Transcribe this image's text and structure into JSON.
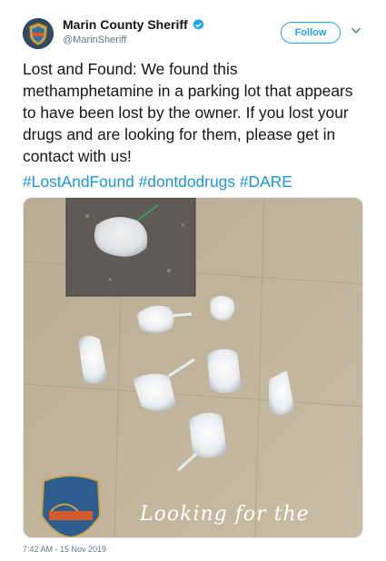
{
  "author": {
    "name": "Marin County Sheriff",
    "handle": "@MarinSheriff",
    "verified_icon": "verified-badge-icon",
    "follow_label": "Follow"
  },
  "tweet": {
    "text": "Lost and Found: We found this methamphetamine in a parking lot that appears to have been lost by the owner. If you lost your drugs and are looking for them, please get in contact with us!",
    "hashtags": [
      "#LostAndFound",
      "#dontdodrugs",
      "#DARE"
    ],
    "timestamp": "7:42 AM - 15 Nov 2019"
  },
  "media": {
    "overlay_text": "Looking for the",
    "badge_text": "SHERIFF'S DEPARTMENT MARIN COUNTY"
  },
  "colors": {
    "accent": "#1da1f2",
    "link": "#1b95e0",
    "text": "#14171a",
    "secondary": "#657786"
  }
}
